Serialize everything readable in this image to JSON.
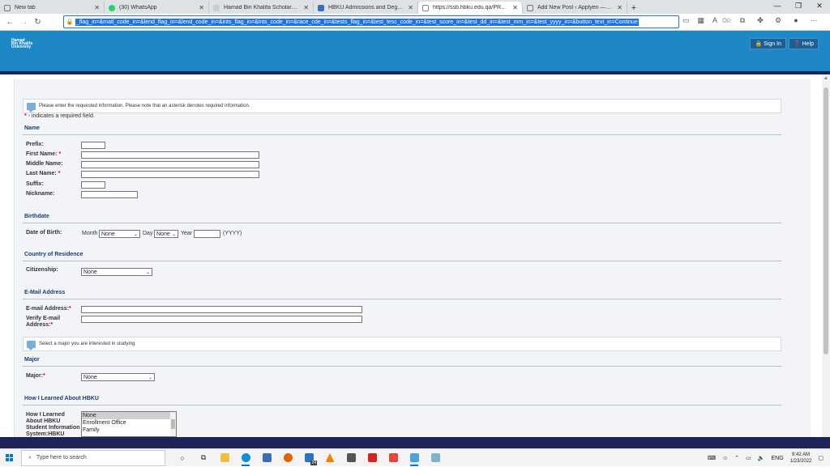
{
  "browser": {
    "tabs": [
      {
        "title": "New tab",
        "color": "#777777",
        "active": false
      },
      {
        "title": "(30) WhatsApp",
        "color": "#25d366",
        "active": false
      },
      {
        "title": "Hamad Bin Khalifa Scholarship &",
        "color": "#bbbbbb",
        "active": false
      },
      {
        "title": "HBKU Admissions and Degree P...",
        "color": "#3a6fb5",
        "active": false
      },
      {
        "title": "https://ssb.hbku.edu.qa/PROD/b...",
        "color": "#999999",
        "active": true
      },
      {
        "title": "Add New Post ‹ Applyen — Wo...",
        "color": "#777777",
        "active": false
      }
    ],
    "new_tab_symbol": "+",
    "url": "_flag_in=&matl_code_in=&lend_flag_in=&lend_code_in=&ints_flag_in=&ints_code_in=&race_cde_in=&tests_flag_in=&test_tesc_code_in=&test_score_in=&test_dd_in=&test_mm_in=&test_yyyy_in=&button_text_in=Continue"
  },
  "header": {
    "logo_lines": [
      "Hamad",
      "Bin Khalifa",
      "University"
    ],
    "signin_label": "🔒 Sign In",
    "help_label": "❓ Help"
  },
  "form": {
    "info_message": "Please enter the requested information. Please note that an asterisk denotes required information.",
    "required_note": "- indicates a required field.",
    "required_star": "*",
    "sections": {
      "name": "Name",
      "birthdate": "Birthdate",
      "country": "Country of Residence",
      "email": "E-Mail Address",
      "major": "Major",
      "learned": "How I Learned About HBKU"
    },
    "labels": {
      "prefix": "Prefix:",
      "first_name": "First Name:",
      "middle_name": "Middle Name:",
      "last_name": "Last Name:",
      "suffix": "Suffix:",
      "nickname": "Nickname:",
      "dob": "Date of Birth:",
      "month": "Month",
      "day": "Day",
      "year": "Year",
      "year_hint": "(YYYY)",
      "citizenship": "Citizenship:",
      "email": "E-mail Address:",
      "verify_email_1": "Verify E-mail",
      "verify_email_2": "Address:",
      "major": "Major:",
      "learned_1": "How I Learned",
      "learned_2": "About HBKU",
      "learned_3": "Student Information",
      "learned_4": "System:HBKU"
    },
    "selects": {
      "month": "None",
      "day": "None",
      "citizenship": "None",
      "major": "None"
    },
    "major_info": "Select a major you are interested in studying",
    "learned_options": [
      "None",
      "Enrollment Office",
      "Family"
    ]
  },
  "taskbar": {
    "search_placeholder": "Type here to search",
    "language": "ENG",
    "time": "9:42 AM",
    "date": "1/23/2022",
    "badge": "24"
  }
}
